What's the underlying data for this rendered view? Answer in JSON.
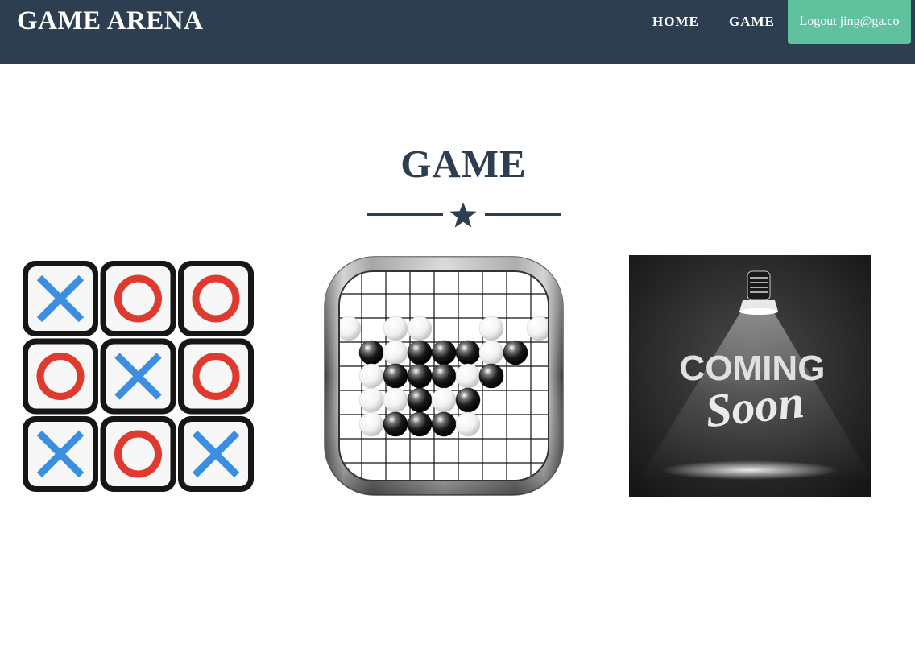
{
  "navbar": {
    "brand": "GAME ARENA",
    "links": {
      "home": "HOME",
      "game": "GAME"
    },
    "logout": "Logout jing@ga.co",
    "colors": {
      "background": "#2c3e50",
      "logout": "#5fc19d"
    }
  },
  "section": {
    "title": "GAME",
    "divider_icon": "star-icon",
    "color": "#2c3e50"
  },
  "games": [
    {
      "name": "tic-tac-toe",
      "icon": "tic-tac-toe-board-icon"
    },
    {
      "name": "gomoku",
      "icon": "gomoku-board-icon"
    },
    {
      "name": "coming-soon",
      "icon": "spotlight-icon",
      "lines": [
        "COMING",
        "Soon"
      ]
    }
  ]
}
